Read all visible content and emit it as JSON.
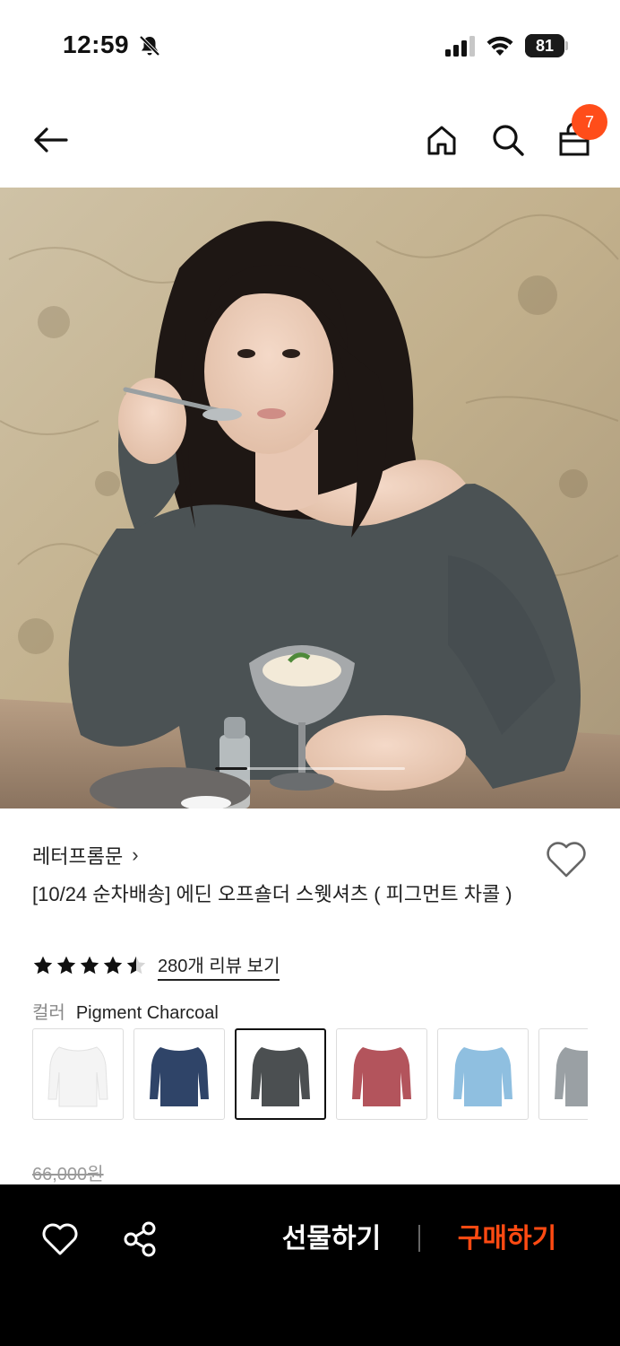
{
  "status_bar": {
    "time": "12:59",
    "battery_level": "81",
    "battery_fraction": 0.81,
    "icons": [
      "bell-muted-icon",
      "cellular-signal-icon",
      "wifi-icon",
      "battery-icon"
    ]
  },
  "nav": {
    "icons": [
      "back-arrow-icon",
      "home-icon",
      "search-icon",
      "shopping-bag-icon"
    ],
    "cart_count": "7",
    "accent_color": "#ff4d1a"
  },
  "hero": {
    "image": "photo of a woman in a charcoal off-shoulder sweatshirt eating ice cream",
    "current_slide_fraction": 0.17
  },
  "product": {
    "brand": "레터프롬문",
    "brand_chevron": "›",
    "title": "[10/24 순차배송] 에딘 오프숄더 스웻셔츠 ( 피그먼트 차콜 )",
    "rating": 4.5,
    "review_link": "280개 리뷰 보기",
    "color_label": "컬러",
    "color_value": "Pigment Charcoal",
    "swatches": [
      {
        "color": "#f4f4f4",
        "selected": false
      },
      {
        "color": "#2f4468",
        "selected": false
      },
      {
        "color": "#4b4f51",
        "selected": true
      },
      {
        "color": "#b3545c",
        "selected": false
      },
      {
        "color": "#8fbfe0",
        "selected": false
      },
      {
        "color": "#9aa0a4",
        "selected": false
      }
    ],
    "original_price": "66,000원"
  },
  "bottom_bar": {
    "gift_label": "선물하기",
    "buy_label": "구매하기",
    "buy_color": "#ff4a12"
  }
}
